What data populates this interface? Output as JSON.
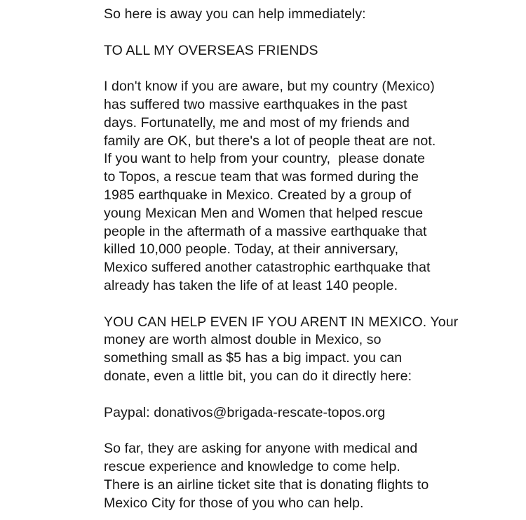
{
  "post": {
    "intro": "So here is away you can help immediately:",
    "heading": "TO ALL MY OVERSEAS FRIENDS",
    "paragraph1": [
      "I don't know if you are aware, but my country (Mexico)",
      "has suffered two massive earthquakes in the past",
      "days. Fortunatelly, me and most of my friends and",
      "family are OK, but there's a lot of people theat are not.",
      "If you want to help from your country,  please donate",
      "to Topos, a rescue team that was formed during the",
      "1985 earthquake in Mexico. Created by a group of",
      "young Mexican Men and Women that helped rescue",
      "people in the aftermath of a massive earthquake that",
      "killed 10,000 people. Today, at their anniversary,",
      "Mexico suffered another catastrophic earthquake that",
      "already has taken the life of at least 140 people."
    ],
    "paragraph2": [
      "YOU CAN HELP EVEN IF YOU ARENT IN MEXICO. Your",
      "money are worth almost double in Mexico, so",
      "something small as $5 has a big impact. you can",
      "donate, even a little bit, you can do it directly here:"
    ],
    "paypal": "Paypal: donativos@brigada-rescate-topos.org",
    "paragraph3": [
      "So far, they are asking for anyone with medical and",
      "rescue experience and knowledge to come help.",
      "There is an airline ticket site that is donating flights to",
      "Mexico City for those of you who can help."
    ]
  }
}
